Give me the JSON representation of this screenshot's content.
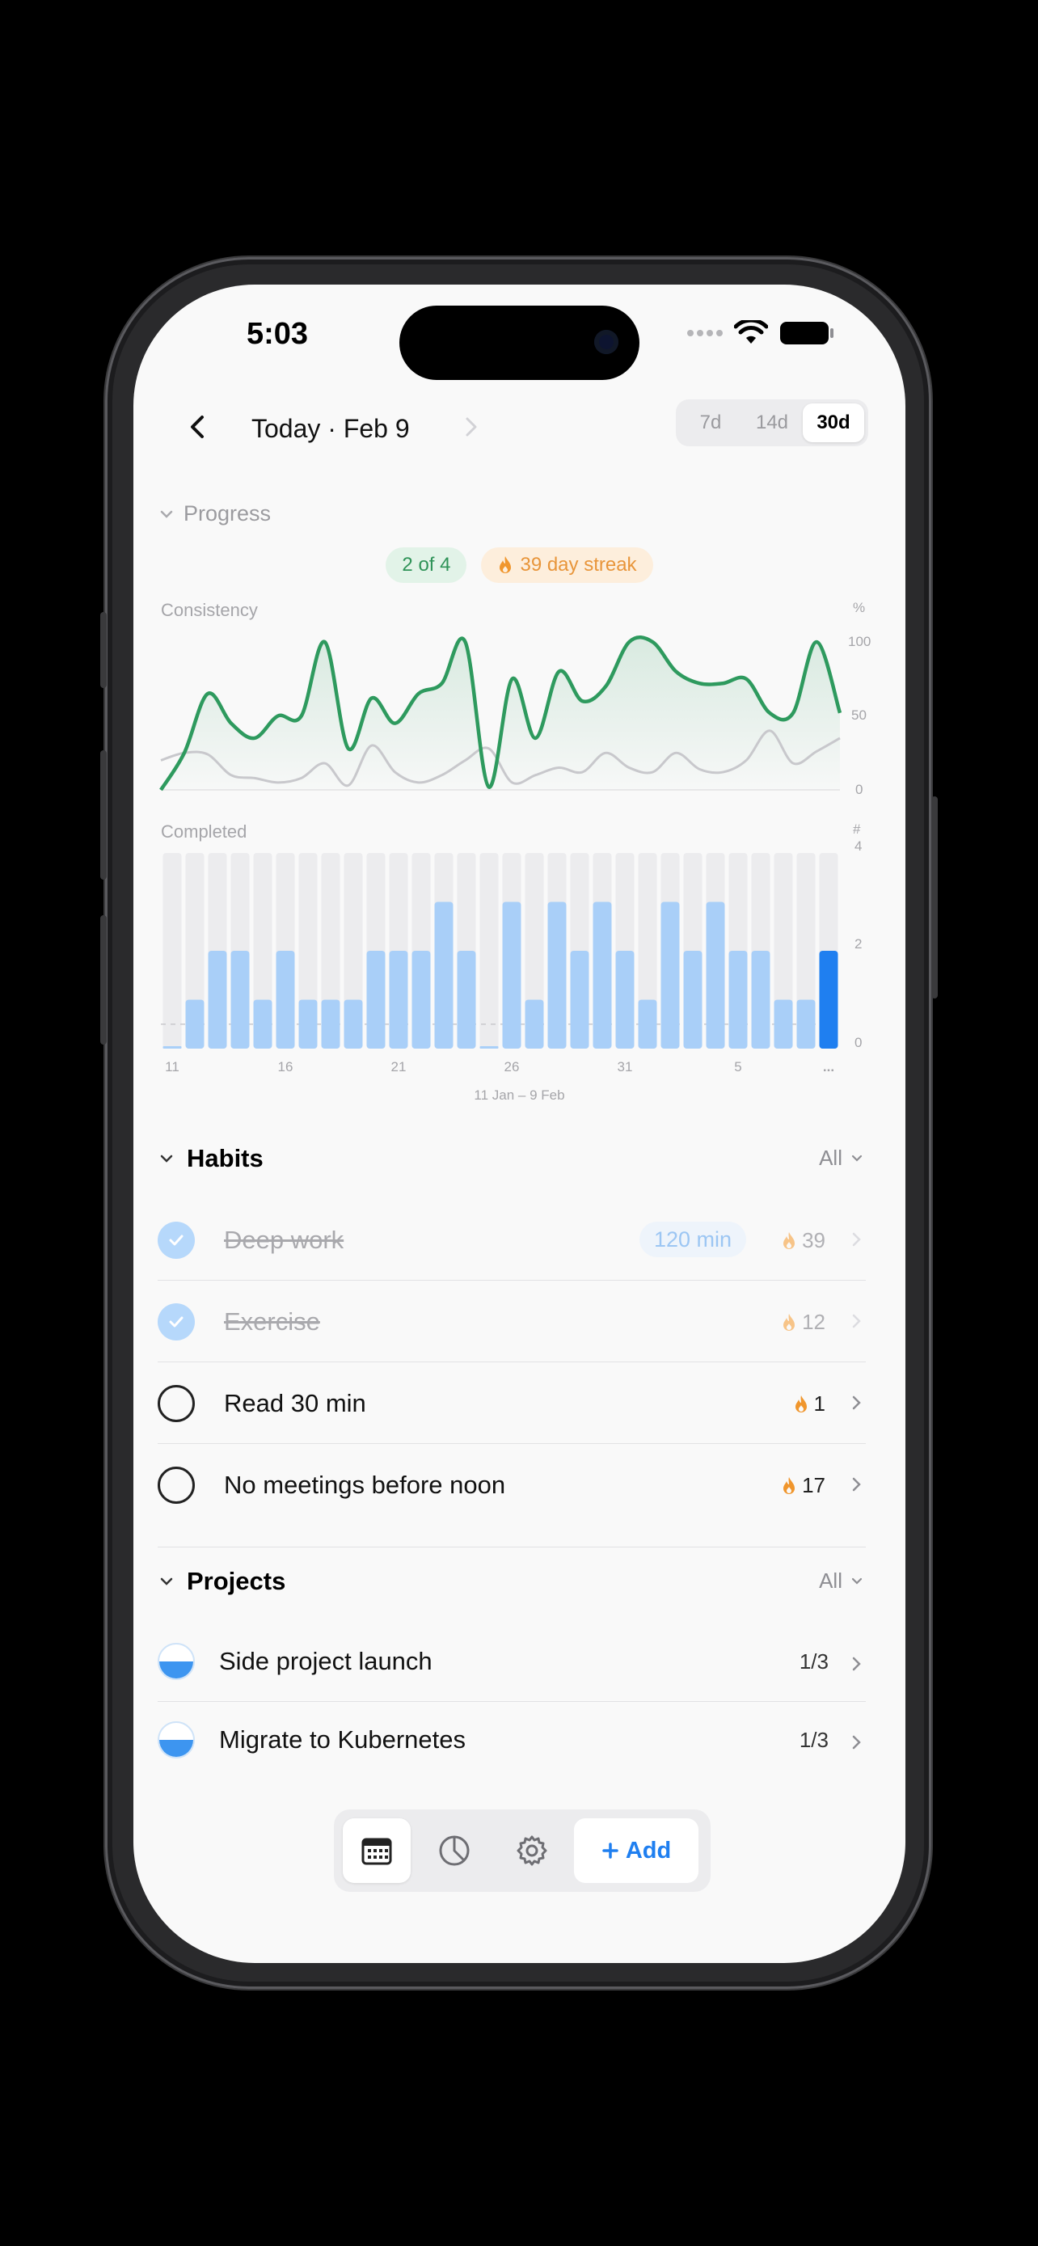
{
  "status_bar": {
    "time": "5:03"
  },
  "nav": {
    "title": "Today · Feb 9",
    "ranges": [
      "7d",
      "14d",
      "30d"
    ],
    "selected_range": "30d"
  },
  "progress": {
    "section_label": "Progress",
    "done_badge": "2 of 4",
    "streak_badge": "39 day streak"
  },
  "chart_data": [
    {
      "type": "line",
      "title": "Consistency",
      "ylabel": "%",
      "y_ticks": [
        "100",
        "50",
        "0"
      ],
      "ylim": [
        0,
        100
      ],
      "series": [
        {
          "values": [
            0,
            25,
            65,
            45,
            35,
            50,
            50,
            100,
            28,
            62,
            45,
            65,
            72,
            100,
            2,
            75,
            35,
            80,
            60,
            70,
            100,
            100,
            80,
            72,
            72,
            75,
            52,
            52,
            100,
            52
          ],
          "color": "#2e9a5e"
        },
        {
          "values": [
            20,
            25,
            24,
            10,
            8,
            5,
            8,
            18,
            3,
            30,
            12,
            5,
            10,
            20,
            28,
            5,
            10,
            15,
            12,
            25,
            15,
            12,
            25,
            14,
            12,
            20,
            40,
            18,
            26,
            35
          ],
          "color": "#c8c8cc"
        }
      ]
    },
    {
      "type": "bar",
      "title": "Completed",
      "ylabel": "#",
      "y_ticks": [
        "4",
        "2",
        "0"
      ],
      "ylim": [
        0,
        4
      ],
      "categories": [
        "11",
        "12",
        "13",
        "14",
        "15",
        "16",
        "17",
        "18",
        "19",
        "20",
        "21",
        "22",
        "23",
        "24",
        "25",
        "26",
        "27",
        "28",
        "29",
        "30",
        "31",
        "1",
        "2",
        "3",
        "4",
        "5",
        "6",
        "7",
        "8",
        "9"
      ],
      "x_ticks": [
        "11",
        "16",
        "21",
        "26",
        "31",
        "5",
        "..."
      ],
      "x_range_label": "11 Jan – 9 Feb",
      "values": [
        0,
        1,
        2,
        2,
        1,
        2,
        1,
        1,
        1,
        2,
        2,
        2,
        3,
        2,
        0,
        3,
        1,
        3,
        2,
        3,
        2,
        1,
        3,
        2,
        3,
        2,
        2,
        1,
        1,
        2
      ],
      "bar_color": "#a9cff8",
      "highlight_color": "#1f7ff0",
      "highlight_index": 29
    }
  ],
  "habits": {
    "title": "Habits",
    "filter": "All",
    "items": [
      {
        "name": "Deep work",
        "done": true,
        "pill": "120 min",
        "streak": "39"
      },
      {
        "name": "Exercise",
        "done": true,
        "pill": "",
        "streak": "12"
      },
      {
        "name": "Read 30 min",
        "done": false,
        "pill": "",
        "streak": "1"
      },
      {
        "name": "No meetings before noon",
        "done": false,
        "pill": "",
        "streak": "17"
      }
    ]
  },
  "projects": {
    "title": "Projects",
    "filter": "All",
    "items": [
      {
        "name": "Side project launch",
        "count": "1/3",
        "progress": 0.5
      },
      {
        "name": "Migrate to Kubernetes",
        "count": "1/3",
        "progress": 0.5
      }
    ]
  },
  "tabbar": {
    "add_label": "Add",
    "active": "calendar"
  },
  "colors": {
    "accent": "#1f7ff0",
    "green": "#2e9a5e",
    "streak": "#f0962d"
  }
}
